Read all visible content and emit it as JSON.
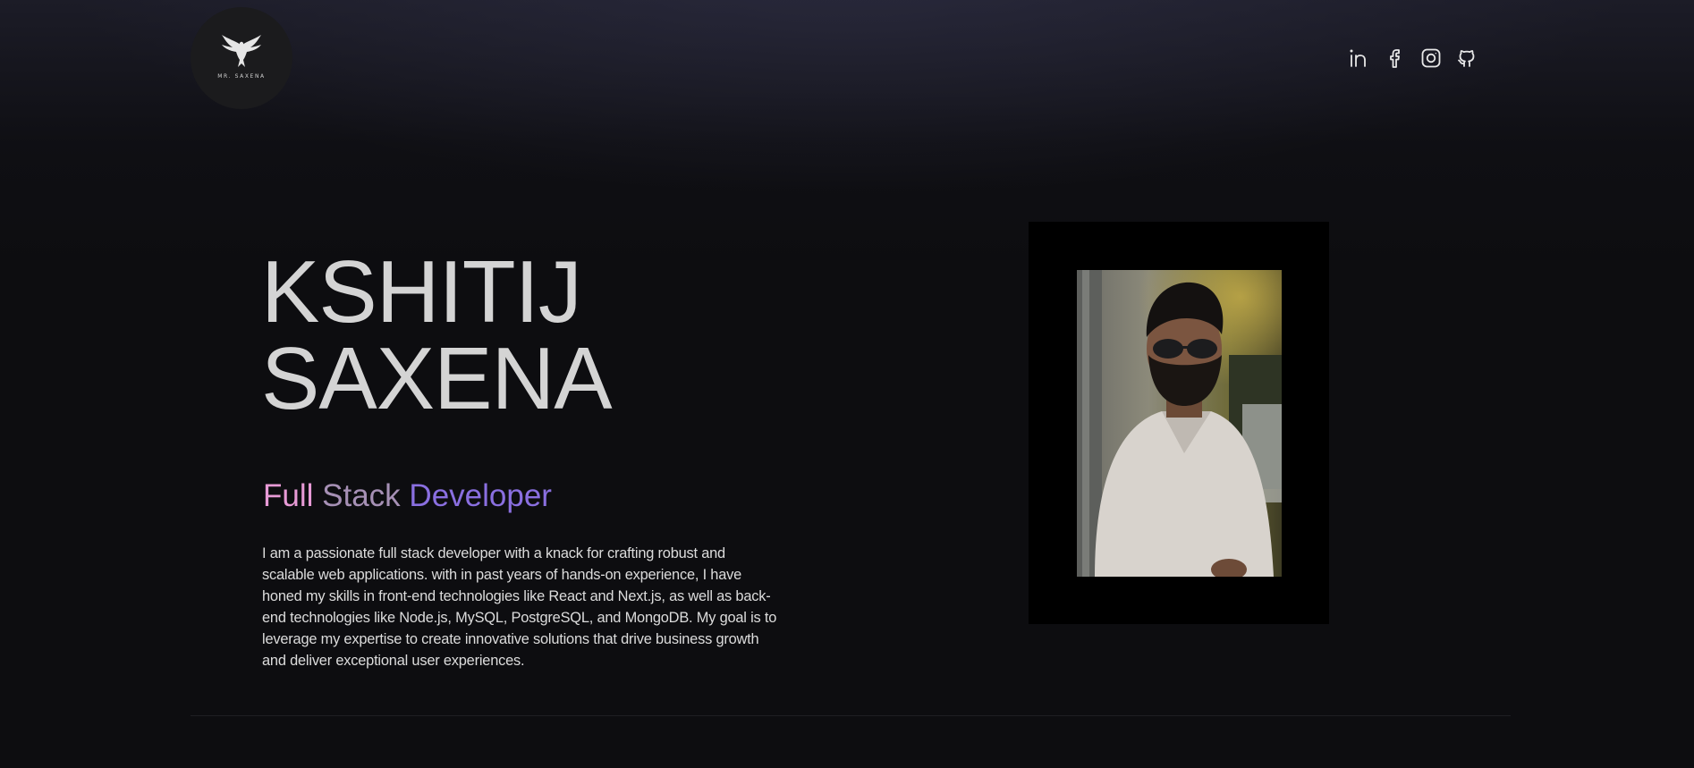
{
  "header": {
    "logo_text": "MR. SAXENA",
    "socials": [
      {
        "name": "LinkedIn",
        "icon": "linkedin-icon"
      },
      {
        "name": "Facebook",
        "icon": "facebook-icon"
      },
      {
        "name": "Instagram",
        "icon": "instagram-icon"
      },
      {
        "name": "GitHub",
        "icon": "github-icon"
      }
    ]
  },
  "hero": {
    "first_name": "KSHITIJ",
    "last_name": "SAXENA",
    "role": {
      "word1": "Full",
      "word2": "Stack",
      "word3": "Developer"
    },
    "bio": "I am a passionate full stack developer with a knack for crafting robust and scalable web applications. with in past years of hands-on experience, I have honed my skills in front-end technologies like React and Next.js, as well as back-end technologies like Node.js, MySQL, PostgreSQL, and MongoDB. My goal is to leverage my expertise to create innovative solutions that drive business growth and deliver exceptional user experiences."
  },
  "colors": {
    "background": "#0c0c0e",
    "name_text": "#d4d4d4",
    "role_gradient": [
      "#e79ad6",
      "#a690b5",
      "#8a6fe0"
    ]
  }
}
